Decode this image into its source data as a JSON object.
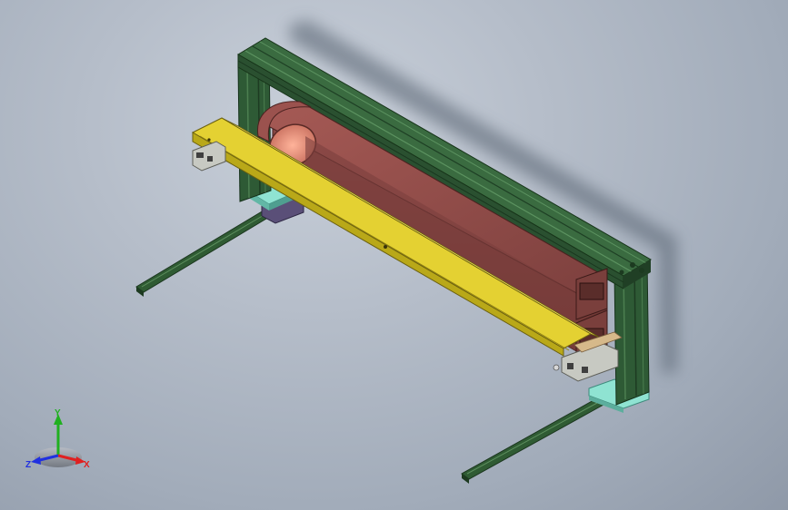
{
  "viewport": {
    "background_top": "#c9d0da",
    "background_bottom": "#8f99a8"
  },
  "model": {
    "frame_color": "#2f5a36",
    "rail_color": "#3c6a3f",
    "tray_color": "#d8c624",
    "tube_color": "#8a4a48",
    "base_plate_color": "#7fd9c9"
  },
  "triad": {
    "y_label": "Y",
    "x_label": "X",
    "z_label": "Z",
    "x_color": "#e02020",
    "y_color": "#20b020",
    "z_color": "#2030e0"
  }
}
